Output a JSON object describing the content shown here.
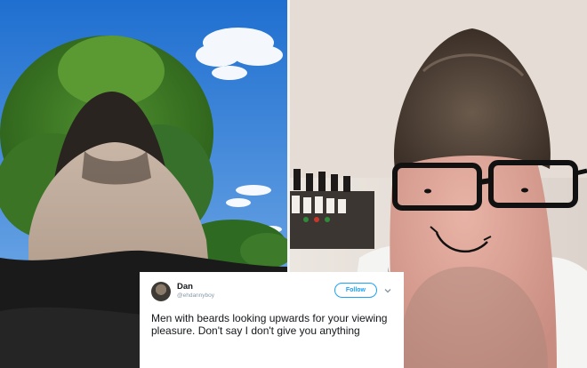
{
  "tweet": {
    "display_name": "Dan",
    "handle": "@ehdannyboy",
    "follow_label": "Follow",
    "text": "Men with beards looking upwards for your viewing pleasure. Don't say I don't give you anything"
  },
  "icons": {
    "more": "chevron-down-icon"
  },
  "colors": {
    "accent": "#1da1f2",
    "text": "#14171a",
    "muted": "#8899a6",
    "card_bg": "#ffffff"
  }
}
